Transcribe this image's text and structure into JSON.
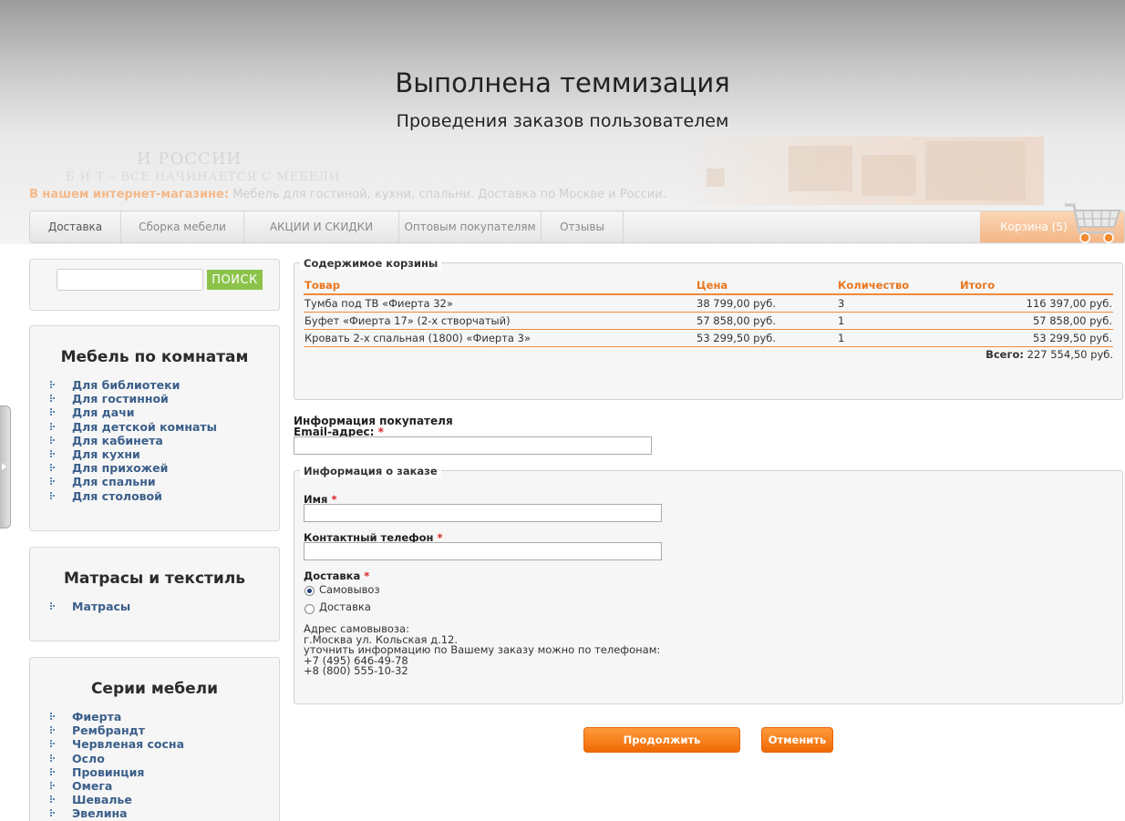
{
  "header": {
    "title": "Выполнена теммизация",
    "subtitle": "Проведения заказов пользователем",
    "ghost_logo": "И РОССИИ",
    "ghost_tag": "Б И Т – ВСЕ НАЧИНАЕТСЯ С МЕБЕЛИ",
    "tagline_highlight": "В нашем интернет-магазине:",
    "tagline_text": " Мебель для гостиной, кухни, спальни. Доставка по Москве и России."
  },
  "nav": {
    "items": [
      "Доставка",
      "Сборка мебели",
      "АКЦИИ И СКИДКИ",
      "Оптовым покупателям",
      "Отзывы"
    ],
    "cart_label": "Корзина (5)"
  },
  "search": {
    "button_label": "ПОИСК",
    "value": ""
  },
  "rooms": {
    "title": "Мебель по комнатам",
    "items": [
      "Для библиотеки",
      "Для гостинной",
      "Для дачи",
      "Для детской комнаты",
      "Для кабинета",
      "Для кухни",
      "Для прихожей",
      "Для спальни",
      "Для столовой"
    ]
  },
  "mattresses": {
    "title": "Матрасы и текстиль",
    "items": [
      "Матрасы"
    ]
  },
  "series": {
    "title": "Серии мебели",
    "items": [
      "Фиерта",
      "Рембрандт",
      "Червленая сосна",
      "Осло",
      "Провинция",
      "Омега",
      "Шевалье",
      "Эвелина"
    ]
  },
  "cart": {
    "legend": "Содержимое корзины",
    "columns": [
      "Товар",
      "Цена",
      "Количество",
      "Итого"
    ],
    "rows": [
      [
        "Тумба под ТВ «Фиерта 32»",
        "38 799,00 руб.",
        "3",
        "116 397,00 руб."
      ],
      [
        "Буфет «Фиерта 17» (2-х створчатый)",
        "57 858,00 руб.",
        "1",
        "57 858,00 руб."
      ],
      [
        "Кровать 2-х спальная (1800) «Фиерта 3»",
        "53 299,50 руб.",
        "1",
        "53 299,50 руб."
      ]
    ],
    "total_label": "Всего:",
    "total_value": " 227 554,50 руб."
  },
  "buyer": {
    "title": "Информация покупателя",
    "email_label": "Email-адрес:",
    "email_value": ""
  },
  "order": {
    "legend": "Информация о заказе",
    "name_label": "Имя",
    "name_value": "",
    "phone_label": "Контактный телефон",
    "phone_value": "",
    "delivery_label": "Доставка",
    "options": [
      "Самовывоз",
      "Доставка"
    ],
    "selected_option": "Самовывоз",
    "address_lines": [
      "Адрес самовывоза:",
      "г.Москва ул. Кольская д.12.",
      "уточнить информацию по Вашему заказу можно по телефонам:",
      "+7 (495) 646-49-78",
      "+8 (800) 555-10-32"
    ]
  },
  "required_mark": "*",
  "buttons": {
    "continue_label": "Продолжить оформление",
    "cancel_label": "Отменить"
  },
  "colors": {
    "accent": "#f07a1c",
    "link": "#3b5f8a",
    "search_button": "#8bc34a"
  }
}
